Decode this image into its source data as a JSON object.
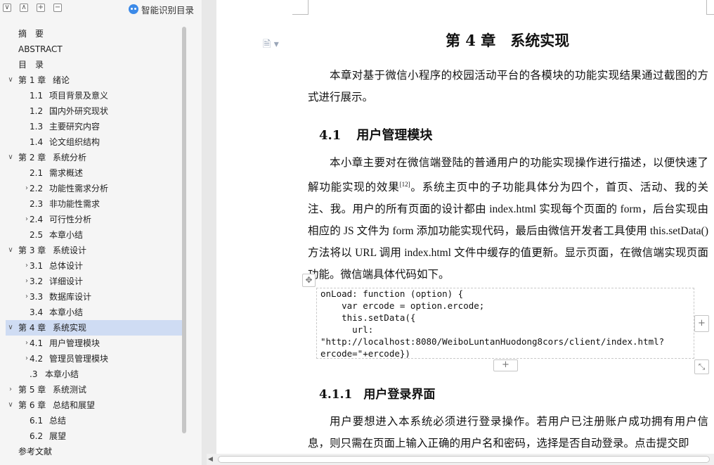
{
  "toolbar": {
    "buttons": [
      "∨",
      "∧",
      "+",
      "−"
    ],
    "smart_toc_label": "智能识别目录"
  },
  "toc": [
    {
      "chev": "",
      "num": "摘　要",
      "title": "",
      "level": 0
    },
    {
      "chev": "",
      "num": "ABSTRACT",
      "title": "",
      "level": 0
    },
    {
      "chev": "",
      "num": "目　录",
      "title": "",
      "level": 0
    },
    {
      "chev": "∨",
      "num": "第 1 章",
      "title": "绪论",
      "level": 0
    },
    {
      "chev": "",
      "num": "1.1",
      "title": "项目背景及意义",
      "level": 1
    },
    {
      "chev": "",
      "num": "1.2",
      "title": "国内外研究现状",
      "level": 1
    },
    {
      "chev": "",
      "num": "1.3",
      "title": "主要研究内容",
      "level": 1
    },
    {
      "chev": "",
      "num": "1.4",
      "title": "论文组织结构",
      "level": 1
    },
    {
      "chev": "∨",
      "num": "第 2 章",
      "title": "系统分析",
      "level": 0
    },
    {
      "chev": "",
      "num": "2.1",
      "title": "需求概述",
      "level": 1
    },
    {
      "chev": "›",
      "num": "2.2",
      "title": "功能性需求分析",
      "level": 1
    },
    {
      "chev": "",
      "num": "2.3",
      "title": "非功能性需求",
      "level": 1
    },
    {
      "chev": "›",
      "num": "2.4",
      "title": "可行性分析",
      "level": 1
    },
    {
      "chev": "",
      "num": "2.5",
      "title": "本章小结",
      "level": 1
    },
    {
      "chev": "∨",
      "num": "第 3 章",
      "title": "系统设计",
      "level": 0
    },
    {
      "chev": "›",
      "num": "3.1",
      "title": "总体设计",
      "level": 1
    },
    {
      "chev": "›",
      "num": "3.2",
      "title": "详细设计",
      "level": 1
    },
    {
      "chev": "›",
      "num": "3.3",
      "title": "数据库设计",
      "level": 1
    },
    {
      "chev": "",
      "num": "3.4",
      "title": "本章小结",
      "level": 1
    },
    {
      "chev": "∨",
      "num": "第 4 章",
      "title": "系统实现",
      "level": 0,
      "selected": true
    },
    {
      "chev": "›",
      "num": "4.1",
      "title": "用户管理模块",
      "level": 1
    },
    {
      "chev": "›",
      "num": "4.2",
      "title": "管理员管理模块",
      "level": 1
    },
    {
      "chev": "",
      "num": ".3",
      "title": "本章小结",
      "level": 1
    },
    {
      "chev": "›",
      "num": "第 5 章",
      "title": "系统测试",
      "level": 0
    },
    {
      "chev": "∨",
      "num": "第 6 章",
      "title": "总结和展望",
      "level": 0
    },
    {
      "chev": "",
      "num": "6.1",
      "title": "总结",
      "level": 1
    },
    {
      "chev": "",
      "num": "6.2",
      "title": "展望",
      "level": 1
    },
    {
      "chev": "",
      "num": "参考文献",
      "title": "",
      "level": 0
    }
  ],
  "doc": {
    "chapter_title": "第 4 章　系统实现",
    "intro": "本章对基于微信小程序的校园活动平台的各模块的功能实现结果通过截图的方式进行展示。",
    "section_num": "4.1",
    "section_title": "用户管理模块",
    "body_part1": "本小章主要对在微信端登陆的普通用户的功能实现操作进行描述，以便快速了解功能实现的效果",
    "body_ref": "[12]",
    "body_part2": "。系统主页中的子功能具体分为四个，首页、活动、我的关注、我。用户的所有页面的设计都由 index.html 实现每个页面的 form，后台实现由相应的 JS 文件为 form 添加功能实现代码，最后由微信开发者工具使用 this.setData()方法将以 URL 调用 index.html 文件中缓存的值更新。显示页面，在微信端实现页面功能。微信端具体代码如下。",
    "code": "onLoad: function (option) {\n    var ercode = option.ercode;\n    this.setData({\n      url:\n\"http://localhost:8080/WeiboLuntanHuodong8cors/client/index.html?\nercode=\"+ercode})",
    "subsection_num": "4.1.1",
    "subsection_title": "用户登录界面",
    "body3": "用户要想进入本系统必须进行登录操作。若用户已注册账户成功拥有用户信息，则只需在页面上输入正确的用户名和密码，选择是否自动登录。点击提交即"
  },
  "controls": {
    "add_row": "+",
    "add_col": "+",
    "move": "✥",
    "resize": "⤡",
    "doc_icon": "🗎 ▾"
  }
}
